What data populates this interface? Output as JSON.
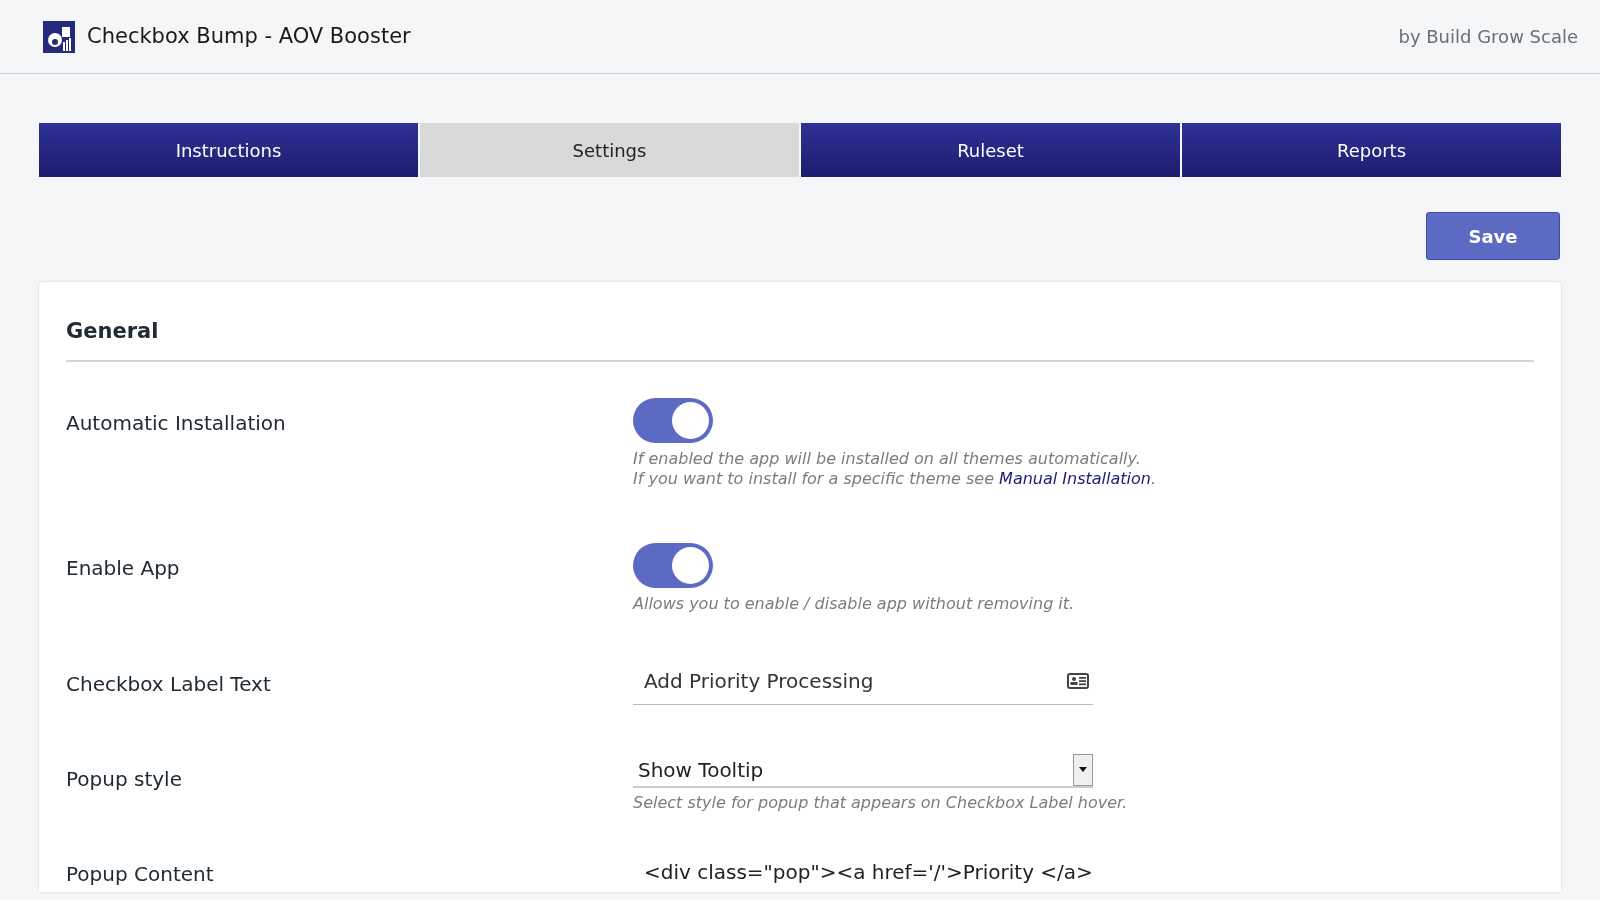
{
  "header": {
    "title": "Checkbox Bump - AOV Booster",
    "byline": "by Build Grow Scale"
  },
  "tabs": [
    {
      "label": "Instructions",
      "selected": false
    },
    {
      "label": "Settings",
      "selected": true
    },
    {
      "label": "Ruleset",
      "selected": false
    },
    {
      "label": "Reports",
      "selected": false
    }
  ],
  "save_button": "Save",
  "section": {
    "title": "General",
    "rows": [
      {
        "kind": "toggle",
        "label": "Automatic Installation",
        "on": true,
        "help": "If enabled the app will be installed on all themes automatically.\nIf you want to install for a specific theme see ",
        "help_link": "Manual Installation",
        "help_after": "."
      },
      {
        "kind": "toggle",
        "label": "Enable App",
        "on": true,
        "help": "Allows you to enable / disable app without removing it."
      },
      {
        "kind": "text",
        "label": "Checkbox Label Text",
        "value": "Add Priority Processing"
      },
      {
        "kind": "select",
        "label": "Popup style",
        "value": "Show Tooltip",
        "help": "Select style for popup that appears on Checkbox Label hover."
      },
      {
        "kind": "textarea",
        "label": "Popup Content",
        "value": "<div class=\"pop\"><a href='/'>Priority </a>"
      }
    ]
  }
}
